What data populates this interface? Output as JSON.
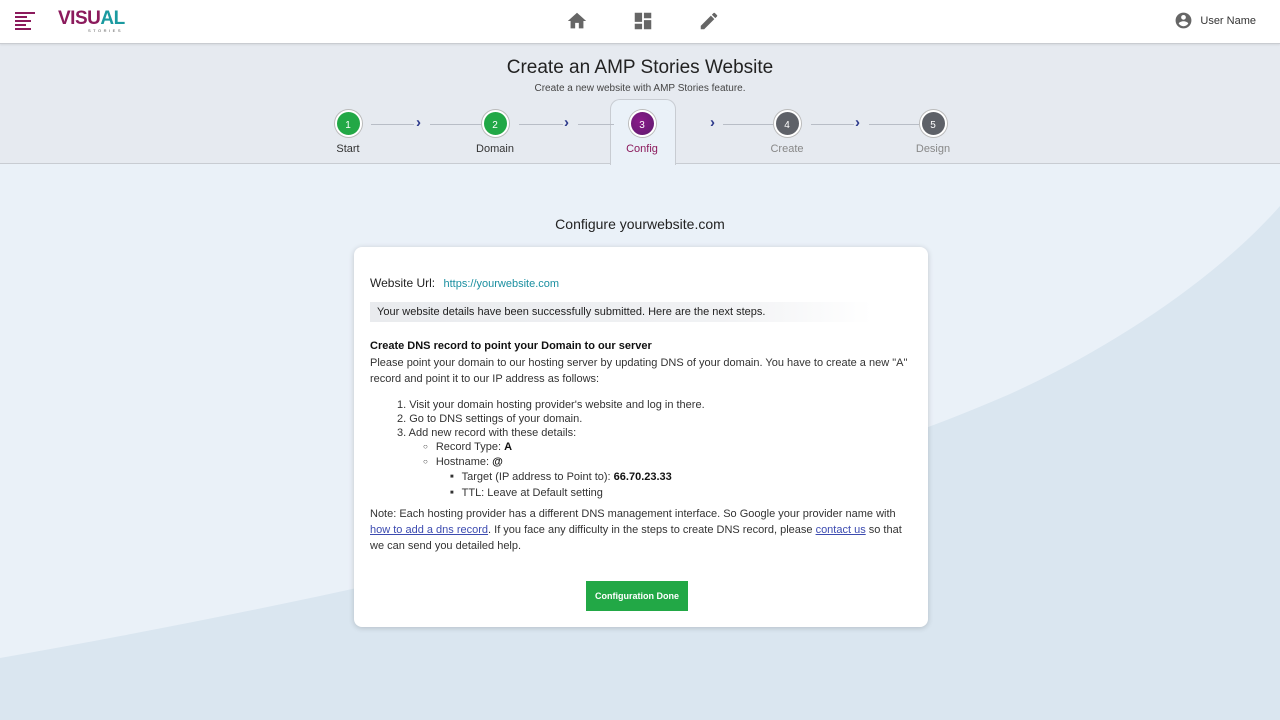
{
  "topbar": {
    "logo_main_a": "VISU",
    "logo_main_b": "AL",
    "logo_sub": "STORIES",
    "nav": [
      "home-icon",
      "dashboard-icon",
      "edit-icon"
    ],
    "user_name": "User Name"
  },
  "header": {
    "title": "Create an AMP Stories Website",
    "subtitle": "Create a new website with AMP Stories feature."
  },
  "stepper": {
    "steps": [
      {
        "number": "1",
        "label": "Start",
        "state": "done"
      },
      {
        "number": "2",
        "label": "Domain",
        "state": "done"
      },
      {
        "number": "3",
        "label": "Config",
        "state": "active"
      },
      {
        "number": "4",
        "label": "Create",
        "state": "pending"
      },
      {
        "number": "5",
        "label": "Design",
        "state": "pending"
      }
    ]
  },
  "content": {
    "configure_title": "Configure yourwebsite.com",
    "url_label": "Website Url:",
    "url_value": "https://yourwebsite.com",
    "notice": "Your website details have been successfully submitted. Here are the next steps.",
    "dns_title": "Create DNS record to point your Domain to our server",
    "dns_desc": "Please point your domain to our hosting server by updating DNS of your domain. You have to create a new \"A\" record and point it to our IP address as follows:",
    "step1": "1. Visit your domain hosting provider's website and log in there.",
    "step2": "2. Go to DNS settings of your domain.",
    "step3": "3. Add new record with these details:",
    "record_type_label": "Record Type:",
    "record_type_value": "A",
    "hostname_label": "Hostname:",
    "hostname_value": "@",
    "target_label": "Target (IP address to Point to):",
    "target_value": "66.70.23.33",
    "ttl_text": "TTL: Leave at Default setting",
    "note_part1": "Note: Each hosting provider has a different DNS management interface. So Google your provider name with ",
    "note_link1": "how to add a dns record",
    "note_part2": ". If you face any difficulty in the steps to create DNS record, please ",
    "note_link2": "contact us",
    "note_part3": " so that we can send you detailed help.",
    "button_label": "Configuration Done"
  },
  "colors": {
    "brand": "#8b1a5c",
    "teal": "#1a9aa0",
    "done_green": "#22a846",
    "pending_gray": "#5e6168"
  }
}
